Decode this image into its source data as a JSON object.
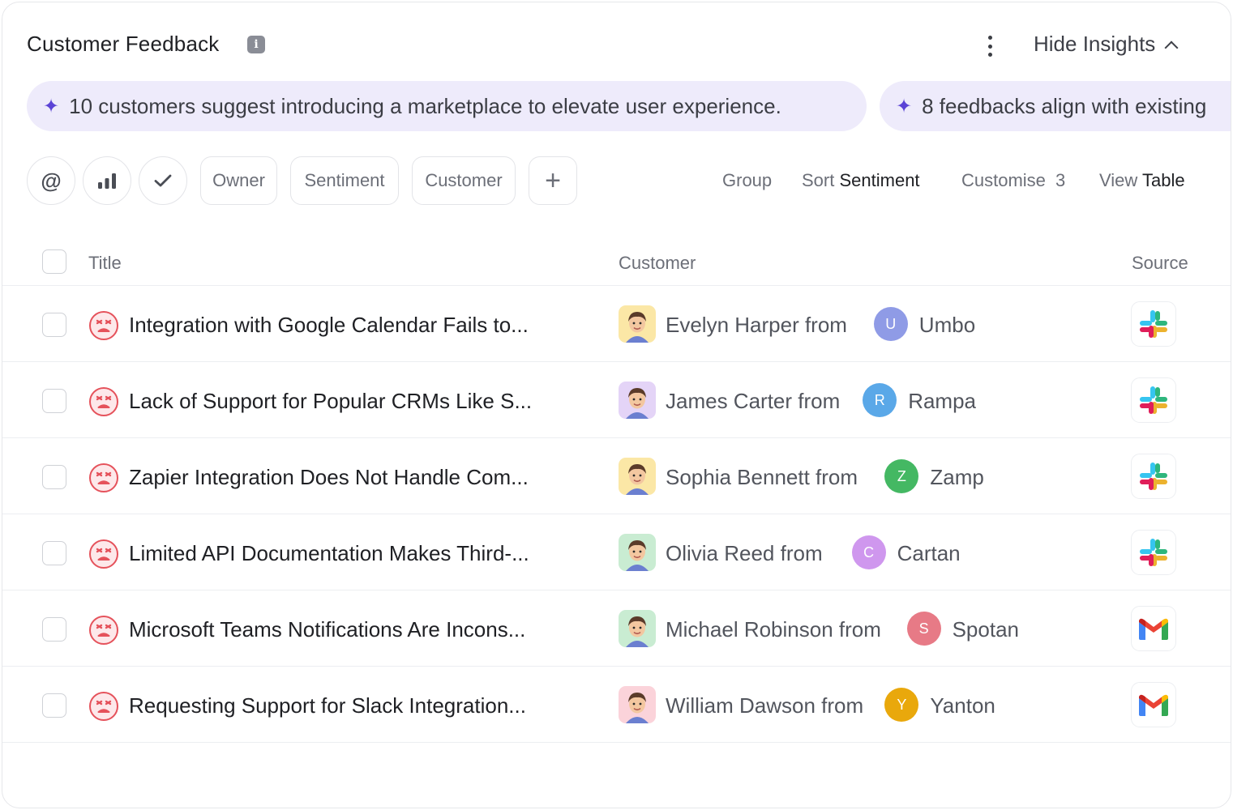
{
  "header": {
    "title": "Customer Feedback",
    "info_icon": "info-icon",
    "more_icon": "more-vertical-icon",
    "hide_insights_label": "Hide Insights"
  },
  "insights": [
    {
      "text": "10 customers suggest introducing a marketplace to elevate user experience.",
      "icon": "sparkle-icon"
    },
    {
      "text": "8 feedbacks align with existing",
      "icon": "sparkle-icon"
    }
  ],
  "filters": {
    "icon_buttons": [
      "mention-icon",
      "bar-chart-icon",
      "check-icon"
    ],
    "chips": [
      "Owner",
      "Sentiment",
      "Customer"
    ],
    "add_icon": "plus-icon"
  },
  "toolbar": {
    "group_label": "Group",
    "sort_label": "Sort",
    "sort_value": "Sentiment",
    "customise_label": "Customise",
    "customise_count": "3",
    "view_label": "View",
    "view_value": "Table"
  },
  "table": {
    "columns": {
      "title": "Title",
      "customer": "Customer",
      "source": "Source"
    },
    "rows": [
      {
        "title": "Integration with Google Calendar Fails to...",
        "person": "Evelyn Harper from",
        "company": "Umbo",
        "initial": "U",
        "badge_color": "#8f9be6",
        "avatar_bg": "#fbe7a6",
        "source": "slack"
      },
      {
        "title": "Lack of Support for Popular CRMs Like S...",
        "person": "James Carter from",
        "company": "Rampa",
        "initial": "R",
        "badge_color": "#5aa8e8",
        "avatar_bg": "#e4d4f7",
        "source": "slack"
      },
      {
        "title": "Zapier Integration Does Not Handle Com...",
        "person": "Sophia Bennett from",
        "company": "Zamp",
        "initial": "Z",
        "badge_color": "#44b863",
        "avatar_bg": "#fbe7a6",
        "source": "slack"
      },
      {
        "title": "Limited API Documentation Makes Third-...",
        "person": "Olivia Reed from",
        "company": "Cartan",
        "initial": "C",
        "badge_color": "#cf97ee",
        "avatar_bg": "#c9ecd2",
        "source": "slack"
      },
      {
        "title": "Microsoft Teams Notifications Are Incons...",
        "person": "Michael Robinson from",
        "company": "Spotan",
        "initial": "S",
        "badge_color": "#e77a86",
        "avatar_bg": "#c9ecd2",
        "source": "gmail"
      },
      {
        "title": "Requesting Support for Slack Integration...",
        "person": "William Dawson from",
        "company": "Yanton",
        "initial": "Y",
        "badge_color": "#e9a80c",
        "avatar_bg": "#fbd3da",
        "source": "gmail"
      }
    ]
  }
}
